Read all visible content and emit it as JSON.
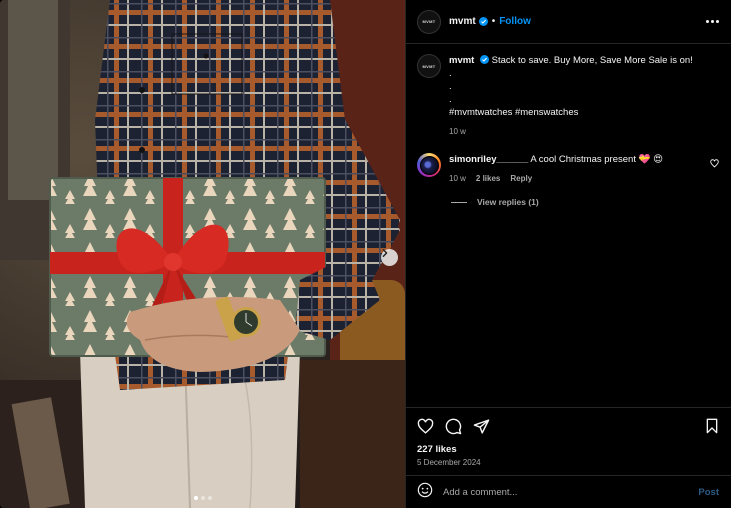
{
  "post": {
    "username": "mvmt",
    "avatar_text": "MVMT",
    "follow_label": "Follow",
    "separator": "•",
    "caption": {
      "text": "Stack to save. Buy More, Save More Sale is on!",
      "bullets": [
        ".",
        ".",
        "."
      ],
      "hashtags": "#mvmtwatches #menswatches",
      "time": "10 w"
    },
    "comments": [
      {
        "username": "simonriley______",
        "text": "A cool Christmas present 💝 😍",
        "time": "10 w",
        "likes": "2 likes",
        "reply_label": "Reply",
        "view_replies": "View replies (1)"
      }
    ],
    "likes": "227 likes",
    "date": "5 December 2024",
    "composer": {
      "placeholder": "Add a comment...",
      "post_label": "Post"
    }
  },
  "media": {
    "slide_count": 3,
    "active_slide": 1
  },
  "colors": {
    "accent": "#0095f6",
    "ribbon": "#c8231d",
    "wrap": "#6f7e6b"
  },
  "icons": [
    "verified-badge-icon",
    "more-options-icon",
    "heart-icon",
    "comment-icon",
    "share-icon",
    "bookmark-icon",
    "emoji-icon",
    "chevron-right-icon"
  ]
}
